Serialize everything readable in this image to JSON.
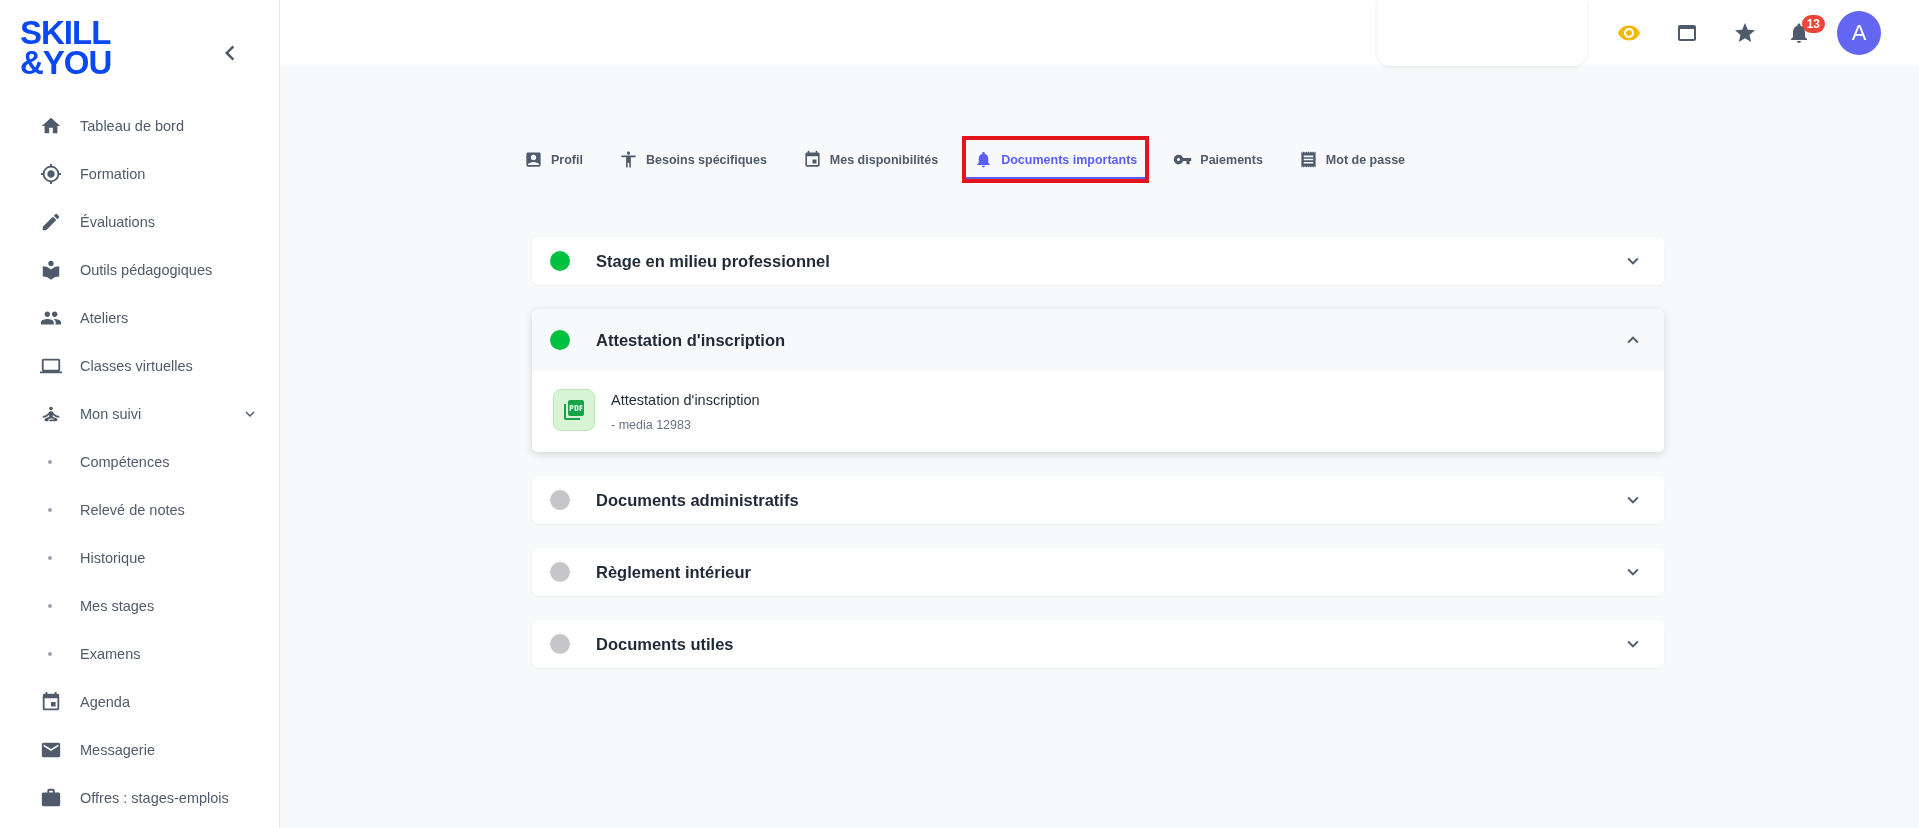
{
  "logo": {
    "line1": "SKILL",
    "line2": "&YOU"
  },
  "sidebar": {
    "items": [
      {
        "label": "Tableau de bord"
      },
      {
        "label": "Formation"
      },
      {
        "label": "Évaluations"
      },
      {
        "label": "Outils pédagogiques"
      },
      {
        "label": "Ateliers"
      },
      {
        "label": "Classes virtuelles"
      },
      {
        "label": "Mon suivi",
        "expanded": true,
        "children": [
          {
            "label": "Compétences"
          },
          {
            "label": "Relevé de notes"
          },
          {
            "label": "Historique"
          },
          {
            "label": "Mes stages"
          },
          {
            "label": "Examens"
          }
        ]
      },
      {
        "label": "Agenda"
      },
      {
        "label": "Messagerie"
      },
      {
        "label": "Offres : stages-emplois"
      }
    ]
  },
  "header": {
    "notifications_count": "13",
    "avatar": "A"
  },
  "tabs": [
    {
      "label": "Profil",
      "selected": false,
      "highlighted": false
    },
    {
      "label": "Besoins spécifiques",
      "selected": false,
      "highlighted": false
    },
    {
      "label": "Mes disponibilités",
      "selected": false,
      "highlighted": false
    },
    {
      "label": "Documents importants",
      "selected": true,
      "highlighted": true
    },
    {
      "label": "Paiements",
      "selected": false,
      "highlighted": false
    },
    {
      "label": "Mot de passe",
      "selected": false,
      "highlighted": false
    }
  ],
  "sections": [
    {
      "title": "Stage en milieu professionnel",
      "color": "#00c040",
      "expanded": false
    },
    {
      "title": "Attestation d'inscription",
      "color": "#00c040",
      "expanded": true,
      "documents": [
        {
          "name": "Attestation d'inscription",
          "meta": "- media 12983"
        }
      ]
    },
    {
      "title": "Documents administratifs",
      "color": "#c4c6ca",
      "expanded": false
    },
    {
      "title": "Règlement intérieur",
      "color": "#c4c6ca",
      "expanded": false
    },
    {
      "title": "Documents utiles",
      "color": "#c4c6ca",
      "expanded": false
    }
  ]
}
